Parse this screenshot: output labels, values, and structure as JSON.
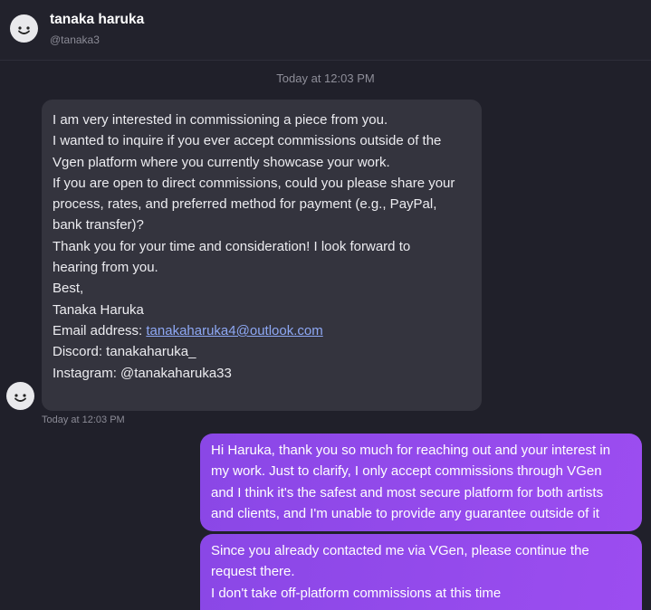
{
  "header": {
    "name": "tanaka haruka",
    "handle": "@tanaka3",
    "avatar_icon": "smiley-face-icon"
  },
  "date_divider": "Today at 12:03 PM",
  "incoming": {
    "avatar_icon": "smiley-face-icon",
    "lines": [
      "I am very interested in commissioning a piece from you.",
      "I wanted to inquire if you ever accept commissions outside of the",
      "Vgen platform where you currently showcase your work.",
      "If you are open to direct commissions, could you please share your",
      "process, rates, and preferred method for payment (e.g., PayPal,",
      "bank transfer)?",
      "Thank you for your time and consideration! I look forward to",
      "hearing from you.",
      "Best,",
      "Tanaka Haruka"
    ],
    "email_label": "Email address: ",
    "email": "tanakaharuka4@outlook.com",
    "discord": "Discord: tanakaharuka_",
    "instagram": "Instagram: @tanakaharuka33",
    "timestamp": "Today at 12:03 PM"
  },
  "outgoing": [
    {
      "lines": [
        "Hi Haruka, thank you so much for reaching out and your interest in",
        "my work. Just to clarify, I only accept commissions through VGen",
        "and I think it's the safest and most secure platform for both artists",
        "and clients, and I'm unable to provide any guarantee outside of it"
      ]
    },
    {
      "lines": [
        "Since you already contacted me via VGen, please continue the",
        "request there.",
        "I don't take off-platform commissions at this time"
      ]
    }
  ],
  "colors": {
    "background": "#20202a",
    "incoming_bubble": "#34343e",
    "outgoing_bubble_start": "#8a47e6",
    "outgoing_bubble_end": "#9c4df0",
    "link": "#8ea8f4"
  }
}
